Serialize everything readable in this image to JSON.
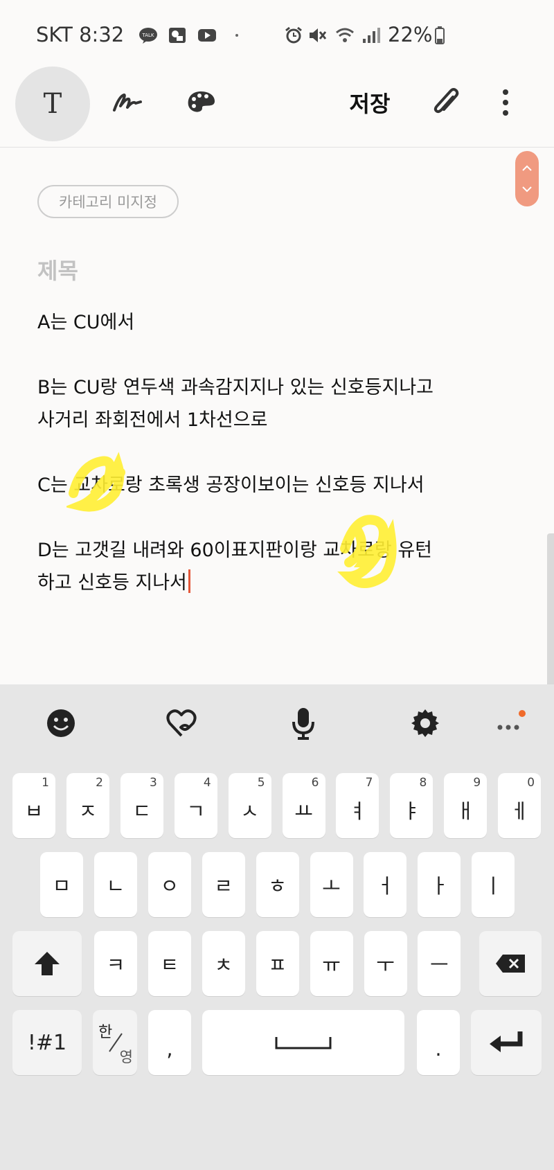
{
  "status": {
    "carrier_time": "SKT 8:32",
    "battery": "22%",
    "icons": [
      "kakaotalk-icon",
      "chat-icon",
      "youtube-icon",
      "dot-icon",
      "alarm-icon",
      "mute-icon",
      "wifi-icon",
      "signal-icon",
      "battery-icon"
    ]
  },
  "toolbar": {
    "text_mode": "T",
    "save_label": "저장",
    "icons": [
      "text-icon",
      "handwriting-icon",
      "palette-icon",
      "attach-icon",
      "more-icon"
    ]
  },
  "note": {
    "category": "카테고리 미지정",
    "title_placeholder": "제목",
    "lines": {
      "a": "A는 CU에서",
      "b1": "B는 CU랑 연두색 과속감지지나 있는 신호등지나고",
      "b2": "사거리 좌회전에서 1차선으로",
      "c": "C는          교차로랑 초록생 공장이보이는 신호등 지나서",
      "d1": "D는 고갯길 내려와 60이표지판이랑           교차로랑 유턴",
      "d2": "하고 신호등 지나서"
    },
    "accent_color": "#e4583a",
    "scroll_color": "#f09a80",
    "highlight_color": "#ffee33"
  },
  "keyboard": {
    "top_icons": [
      "emoji-icon",
      "sticker-icon",
      "mic-icon",
      "settings-icon",
      "more-dots-icon"
    ],
    "row1": [
      {
        "k": "ㅂ",
        "n": "1"
      },
      {
        "k": "ㅈ",
        "n": "2"
      },
      {
        "k": "ㄷ",
        "n": "3"
      },
      {
        "k": "ㄱ",
        "n": "4"
      },
      {
        "k": "ㅅ",
        "n": "5"
      },
      {
        "k": "ㅛ",
        "n": "6"
      },
      {
        "k": "ㅕ",
        "n": "7"
      },
      {
        "k": "ㅑ",
        "n": "8"
      },
      {
        "k": "ㅐ",
        "n": "9"
      },
      {
        "k": "ㅔ",
        "n": "0"
      }
    ],
    "row2": [
      "ㅁ",
      "ㄴ",
      "ㅇ",
      "ㄹ",
      "ㅎ",
      "ㅗ",
      "ㅓ",
      "ㅏ",
      "ㅣ"
    ],
    "row3": [
      "ㅋ",
      "ㅌ",
      "ㅊ",
      "ㅍ",
      "ㅠ",
      "ㅜ",
      "ㅡ"
    ],
    "symbols": "!#1",
    "lang_top": "한",
    "lang_bottom": "영",
    "comma": ",",
    "period": "."
  }
}
